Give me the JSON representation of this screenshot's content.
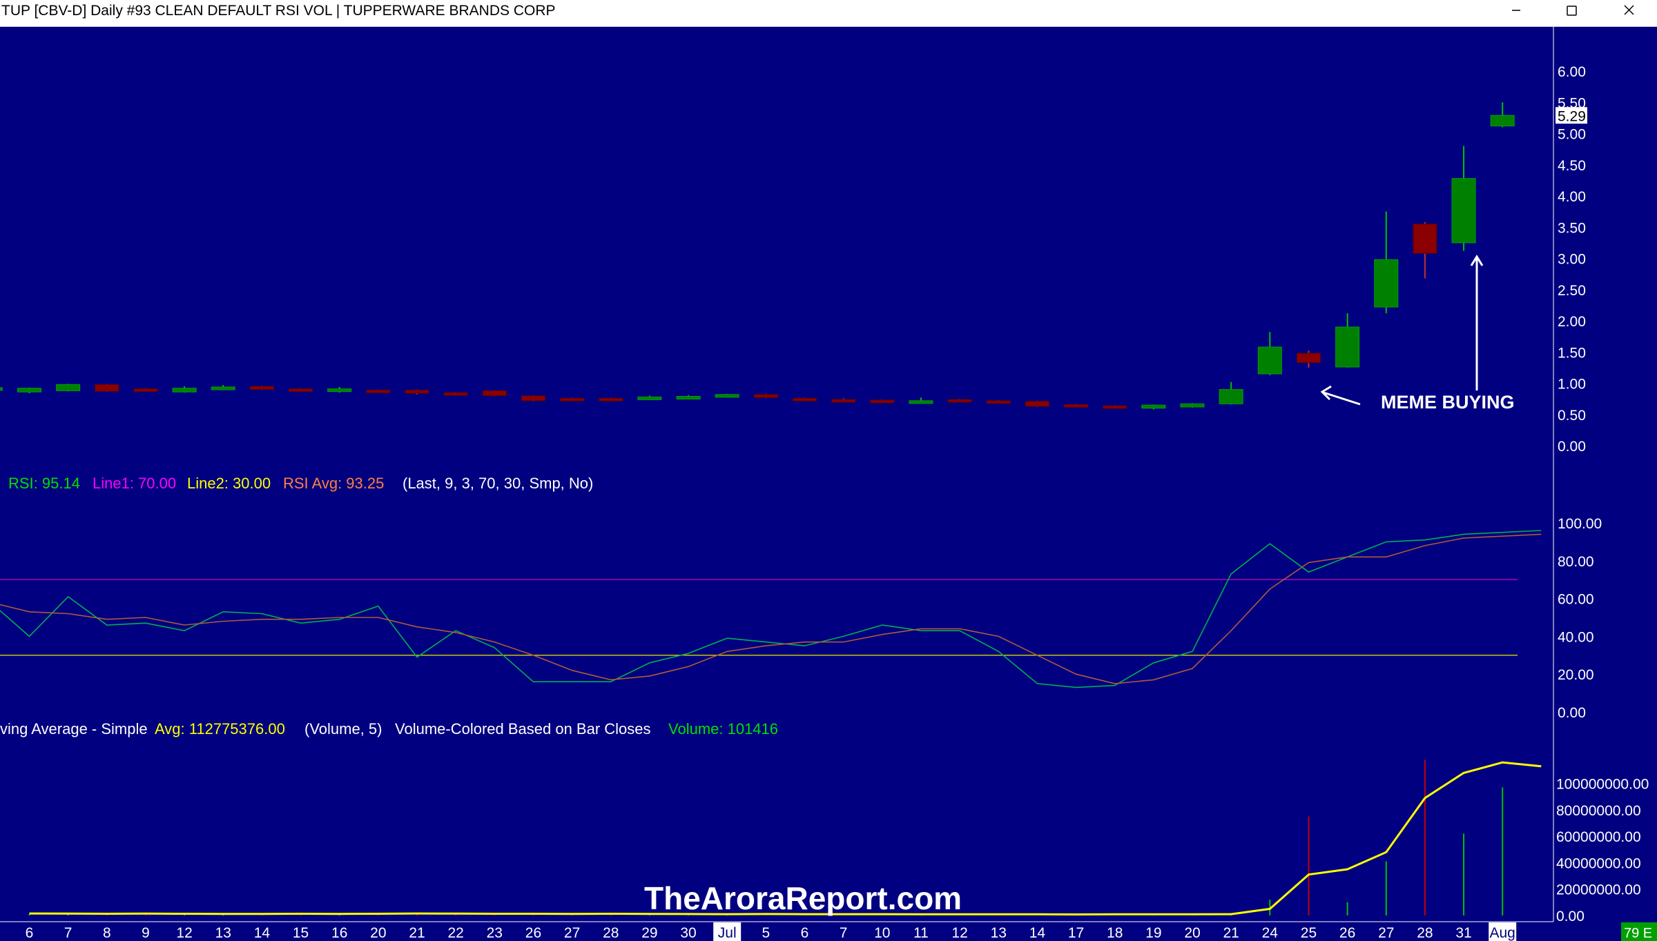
{
  "window": {
    "title": "TUP [CBV-D]  Daily  #93 CLEAN DEFAULT RSI VOL | TUPPERWARE BRANDS CORP",
    "minimize_icon": "minimize-icon",
    "maximize_icon": "maximize-icon",
    "close_icon": "close-icon"
  },
  "colors": {
    "background": "#000080",
    "up": "#008000",
    "down": "#8b0000",
    "rsi": "#00b050",
    "rsi_avg": "#b05a3a",
    "line1": "#b000b0",
    "line2": "#c8c800",
    "volume_avg": "#ffff00",
    "volume_up": "#00c000",
    "volume_down": "#c00000"
  },
  "chart_data": [
    {
      "type": "candlestick",
      "panel": "price",
      "ylim": [
        0,
        6.0
      ],
      "yticks": [
        "6.00",
        "5.50",
        "5.00",
        "4.50",
        "4.00",
        "3.50",
        "3.00",
        "2.50",
        "2.00",
        "1.50",
        "1.00",
        "0.50",
        "0.00"
      ],
      "last_price_label": "5.29",
      "x_labels": [
        "6",
        "7",
        "8",
        "9",
        "12",
        "13",
        "14",
        "15",
        "16",
        "20",
        "21",
        "22",
        "23",
        "26",
        "27",
        "28",
        "29",
        "30",
        "Jul",
        "5",
        "6",
        "7",
        "10",
        "11",
        "12",
        "13",
        "14",
        "17",
        "18",
        "19",
        "20",
        "21",
        "24",
        "25",
        "26",
        "27",
        "28",
        "31",
        "Aug"
      ],
      "candles": [
        {
          "o": 0.92,
          "h": 0.95,
          "l": 0.9,
          "c": 0.93
        },
        {
          "o": 0.86,
          "h": 0.93,
          "l": 0.84,
          "c": 0.92
        },
        {
          "o": 0.88,
          "h": 0.99,
          "l": 0.87,
          "c": 0.98
        },
        {
          "o": 0.98,
          "h": 0.99,
          "l": 0.86,
          "c": 0.87
        },
        {
          "o": 0.91,
          "h": 0.92,
          "l": 0.87,
          "c": 0.88
        },
        {
          "o": 0.86,
          "h": 0.95,
          "l": 0.85,
          "c": 0.92
        },
        {
          "o": 0.9,
          "h": 0.97,
          "l": 0.89,
          "c": 0.94
        },
        {
          "o": 0.95,
          "h": 0.96,
          "l": 0.89,
          "c": 0.9
        },
        {
          "o": 0.91,
          "h": 0.92,
          "l": 0.89,
          "c": 0.9
        },
        {
          "o": 0.89,
          "h": 0.94,
          "l": 0.85,
          "c": 0.91
        },
        {
          "o": 0.89,
          "h": 0.9,
          "l": 0.87,
          "c": 0.88
        },
        {
          "o": 0.89,
          "h": 0.9,
          "l": 0.82,
          "c": 0.84
        },
        {
          "o": 0.85,
          "h": 0.86,
          "l": 0.8,
          "c": 0.82
        },
        {
          "o": 0.88,
          "h": 0.89,
          "l": 0.79,
          "c": 0.8
        },
        {
          "o": 0.8,
          "h": 0.81,
          "l": 0.71,
          "c": 0.72
        },
        {
          "o": 0.76,
          "h": 0.77,
          "l": 0.73,
          "c": 0.74
        },
        {
          "o": 0.76,
          "h": 0.77,
          "l": 0.72,
          "c": 0.73
        },
        {
          "o": 0.74,
          "h": 0.8,
          "l": 0.73,
          "c": 0.78
        },
        {
          "o": 0.77,
          "h": 0.81,
          "l": 0.76,
          "c": 0.79
        },
        {
          "o": 0.78,
          "h": 0.83,
          "l": 0.77,
          "c": 0.82
        },
        {
          "o": 0.82,
          "h": 0.83,
          "l": 0.76,
          "c": 0.77
        },
        {
          "o": 0.76,
          "h": 0.77,
          "l": 0.73,
          "c": 0.74
        },
        {
          "o": 0.74,
          "h": 0.76,
          "l": 0.72,
          "c": 0.73
        },
        {
          "o": 0.73,
          "h": 0.74,
          "l": 0.7,
          "c": 0.71
        },
        {
          "o": 0.71,
          "h": 0.77,
          "l": 0.7,
          "c": 0.72
        },
        {
          "o": 0.74,
          "h": 0.75,
          "l": 0.69,
          "c": 0.7
        },
        {
          "o": 0.72,
          "h": 0.73,
          "l": 0.69,
          "c": 0.7
        },
        {
          "o": 0.71,
          "h": 0.72,
          "l": 0.62,
          "c": 0.63
        },
        {
          "o": 0.66,
          "h": 0.67,
          "l": 0.63,
          "c": 0.64
        },
        {
          "o": 0.64,
          "h": 0.65,
          "l": 0.61,
          "c": 0.62
        },
        {
          "o": 0.6,
          "h": 0.66,
          "l": 0.58,
          "c": 0.65
        },
        {
          "o": 0.62,
          "h": 0.68,
          "l": 0.61,
          "c": 0.67
        },
        {
          "o": 0.67,
          "h": 1.02,
          "l": 0.66,
          "c": 0.9
        },
        {
          "o": 1.15,
          "h": 1.82,
          "l": 1.13,
          "c": 1.58
        },
        {
          "o": 1.48,
          "h": 1.52,
          "l": 1.25,
          "c": 1.33
        },
        {
          "o": 1.26,
          "h": 2.12,
          "l": 1.25,
          "c": 1.9
        },
        {
          "o": 2.22,
          "h": 3.75,
          "l": 2.12,
          "c": 2.98
        },
        {
          "o": 3.55,
          "h": 3.58,
          "l": 2.68,
          "c": 3.08
        },
        {
          "o": 3.25,
          "h": 4.8,
          "l": 3.12,
          "c": 4.28
        },
        {
          "o": 5.12,
          "h": 5.5,
          "l": 5.1,
          "c": 5.29
        }
      ]
    },
    {
      "type": "line",
      "panel": "rsi",
      "legend": {
        "rsi": "RSI: 95.14",
        "line1": "Line1: 70.00",
        "line2": "Line2: 30.00",
        "rsi_avg": "RSI Avg: 93.25",
        "params": "(Last, 9, 3, 70, 30, Smp, No)"
      },
      "ylim": [
        0,
        100
      ],
      "yticks": [
        "100.00",
        "80.00",
        "60.00",
        "40.00",
        "20.00",
        "0.00"
      ],
      "line1": 70,
      "line2": 30,
      "series": [
        {
          "name": "RSI: 95.14",
          "values": [
            58,
            40,
            61,
            46,
            47,
            43,
            53,
            52,
            47,
            49,
            56,
            29,
            43,
            34,
            16,
            16,
            16,
            26,
            31,
            39,
            37,
            35,
            40,
            46,
            43,
            43,
            32,
            15,
            13,
            14,
            26,
            32,
            73,
            89,
            74,
            82,
            90,
            91,
            94,
            95,
            96
          ]
        },
        {
          "name": "RSI Avg: 93.25",
          "values": [
            58,
            53,
            52,
            49,
            50,
            46,
            48,
            49,
            49,
            50,
            50,
            45,
            42,
            37,
            30,
            22,
            17,
            19,
            24,
            32,
            35,
            37,
            37,
            41,
            44,
            44,
            40,
            30,
            20,
            15,
            17,
            23,
            43,
            65,
            79,
            82,
            82,
            88,
            92,
            93,
            94
          ]
        }
      ]
    },
    {
      "type": "bar",
      "panel": "volume",
      "legend": {
        "name": "ving Average - Simple",
        "avg": "Avg: 112775376.00",
        "params": "(Volume, 5)",
        "note": "Volume-Colored Based on Bar Closes",
        "volume": "Volume: 101416"
      },
      "ylim": [
        0,
        115000000
      ],
      "yticks": [
        "100000000.00",
        "80000000.00",
        "60000000.00",
        "40000000.00",
        "20000000.00",
        "0.00"
      ],
      "volume": [
        1200000,
        900000,
        1500000,
        1100000,
        800000,
        1000000,
        1300000,
        900000,
        1000000,
        1400000,
        1100000,
        900000,
        1000000,
        1500000,
        1200000,
        800000,
        900000,
        1000000,
        900000,
        1100000,
        800000,
        700000,
        900000,
        1000000,
        800000,
        700000,
        900000,
        600000,
        1200000,
        700000,
        800000,
        1000000,
        12000000,
        75000000,
        10000000,
        41000000,
        118000000,
        62000000,
        97000000,
        101416
      ],
      "moving_average": [
        1500000,
        1400000,
        1300000,
        1400000,
        1300000,
        1200000,
        1200000,
        1300000,
        1200000,
        1300000,
        1500000,
        1400000,
        1300000,
        1300000,
        1200000,
        1300000,
        1200000,
        1100000,
        1000000,
        1100000,
        1000000,
        1000000,
        1000000,
        900000,
        900000,
        900000,
        900000,
        800000,
        900000,
        900000,
        900000,
        1000000,
        5000000,
        31000000,
        35000000,
        48000000,
        89000000,
        108000000,
        116000000,
        113000000
      ]
    }
  ],
  "annotation": {
    "text": "MEME BUYING"
  },
  "watermark": "TheAroraReport.com",
  "status_badge": "79 E"
}
